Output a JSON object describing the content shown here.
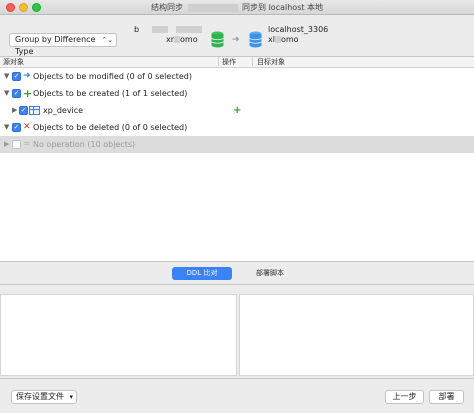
{
  "window": {
    "title_prefix": "结构同步",
    "title_suffix": "同步到 localhost 本地"
  },
  "header": {
    "group_by": "Group by Difference Type",
    "source": {
      "line1_prefix": "b",
      "line2_prefix": "xr",
      "line2_suffix": "omo"
    },
    "target": {
      "line1": "localhost_3306",
      "line2_prefix": "xl",
      "line2_suffix": "omo"
    }
  },
  "columns": {
    "source": "源对象",
    "operation": "操作",
    "target": "目标对象"
  },
  "tree": {
    "modified": "Objects to be modified (0 of 0 selected)",
    "created": "Objects to be created (1 of 1 selected)",
    "created_child": "xp_device",
    "deleted": "Objects to be deleted (0 of 0 selected)",
    "no_operation": "No operation (10 objects)"
  },
  "tabs": {
    "ddl_compare": "DDL 比对",
    "deploy_script": "部署脚本"
  },
  "footer": {
    "save_settings": "保存设置文件",
    "previous": "上一步",
    "deploy": "部署"
  },
  "colors": {
    "accent": "#3b82f6",
    "create_green": "#2aa52a",
    "delete_red": "#d9342b",
    "modify_blue": "#3f7fd6"
  }
}
